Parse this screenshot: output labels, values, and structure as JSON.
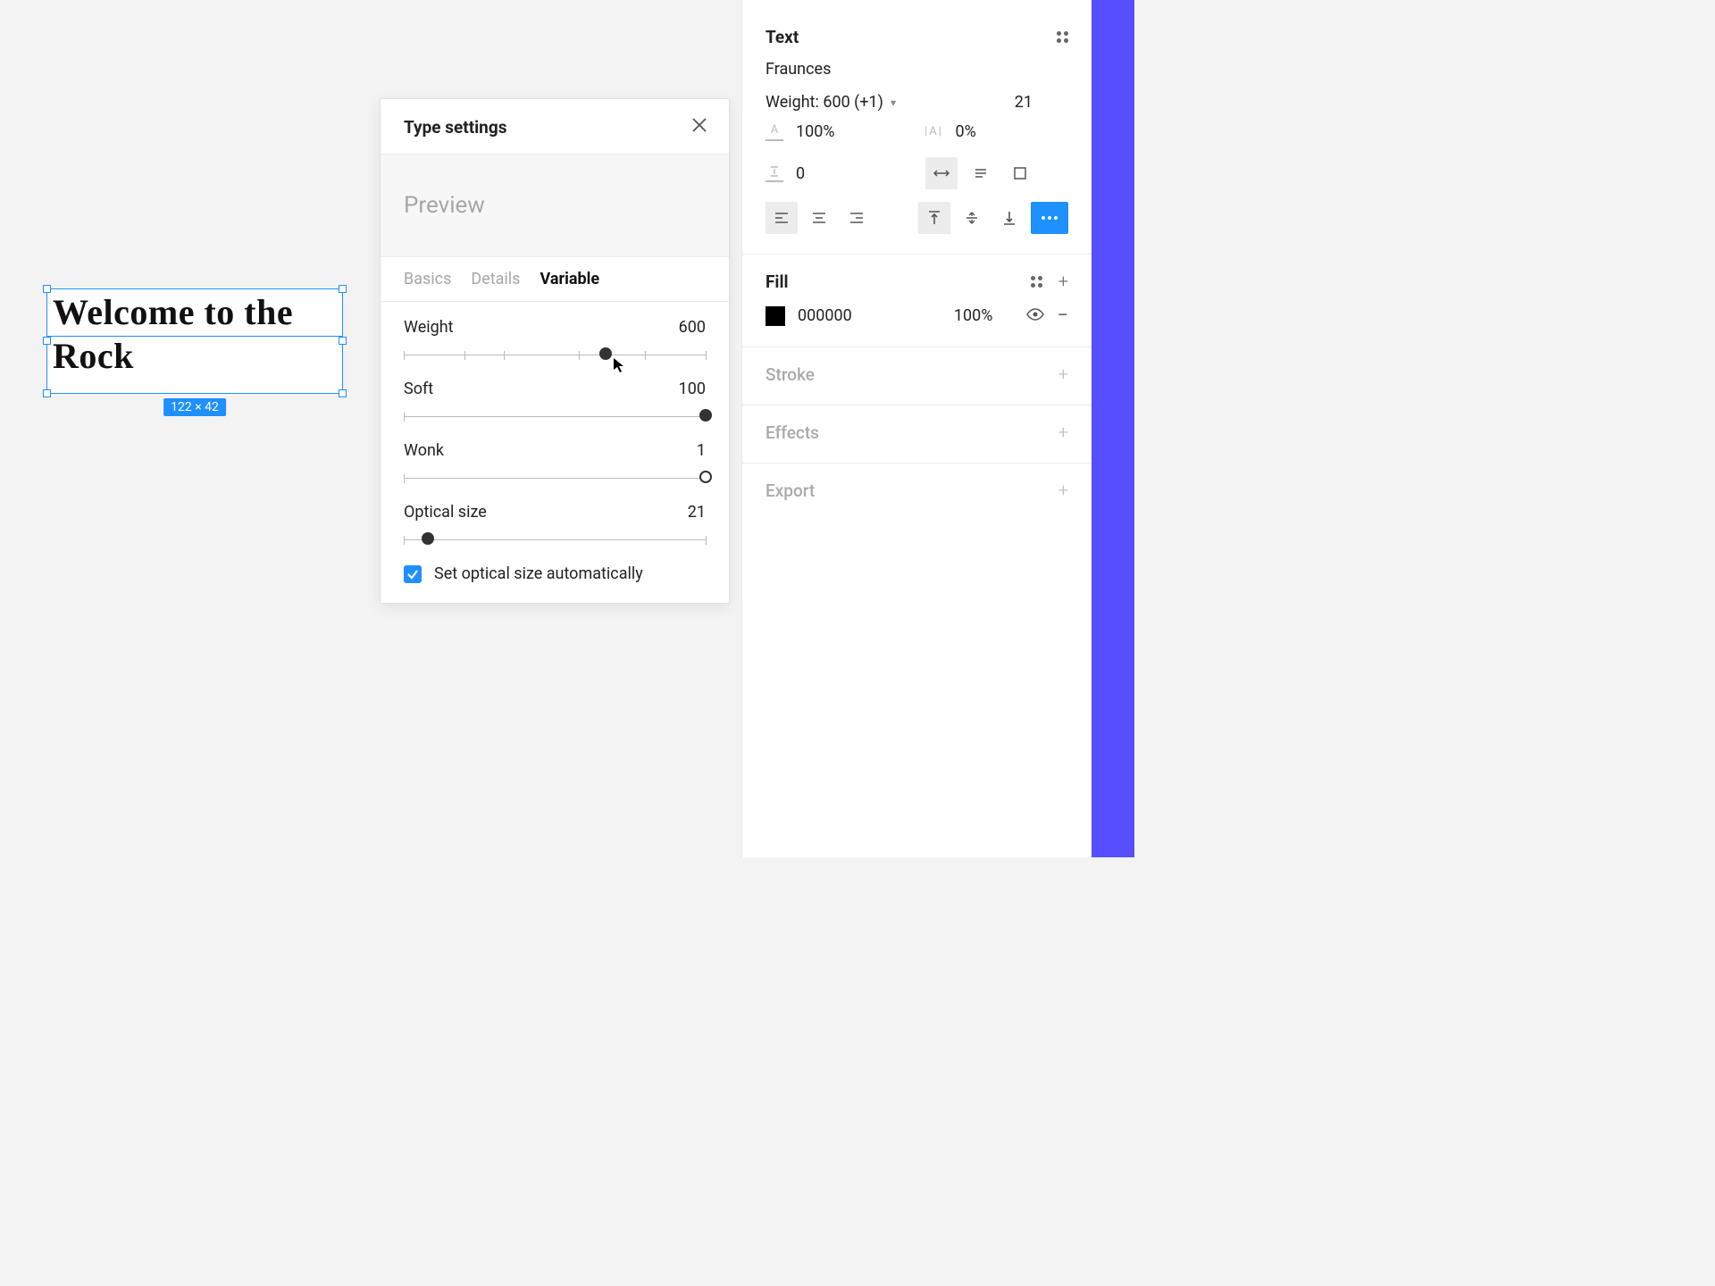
{
  "canvas": {
    "text": "Welcome to the Rock",
    "dimensions": "122 × 42"
  },
  "popover": {
    "title": "Type settings",
    "preview_label": "Preview",
    "tabs": {
      "basics": "Basics",
      "details": "Details",
      "variable": "Variable"
    },
    "sliders": {
      "weight": {
        "label": "Weight",
        "value": "600",
        "percent": 67
      },
      "soft": {
        "label": "Soft",
        "value": "100",
        "percent": 100
      },
      "wonk": {
        "label": "Wonk",
        "value": "1",
        "percent": 100
      },
      "optical": {
        "label": "Optical size",
        "value": "21",
        "percent": 8
      }
    },
    "checkbox_label": "Set optical size automatically"
  },
  "sidebar": {
    "text": {
      "title": "Text",
      "font": "Fraunces",
      "weight_label": "Weight: 600 (+1)",
      "size": "21",
      "line_height": "100%",
      "letter_spacing": "0%",
      "paragraph_spacing": "0"
    },
    "fill": {
      "title": "Fill",
      "hex": "000000",
      "opacity": "100%"
    },
    "stroke_title": "Stroke",
    "effects_title": "Effects",
    "export_title": "Export"
  }
}
